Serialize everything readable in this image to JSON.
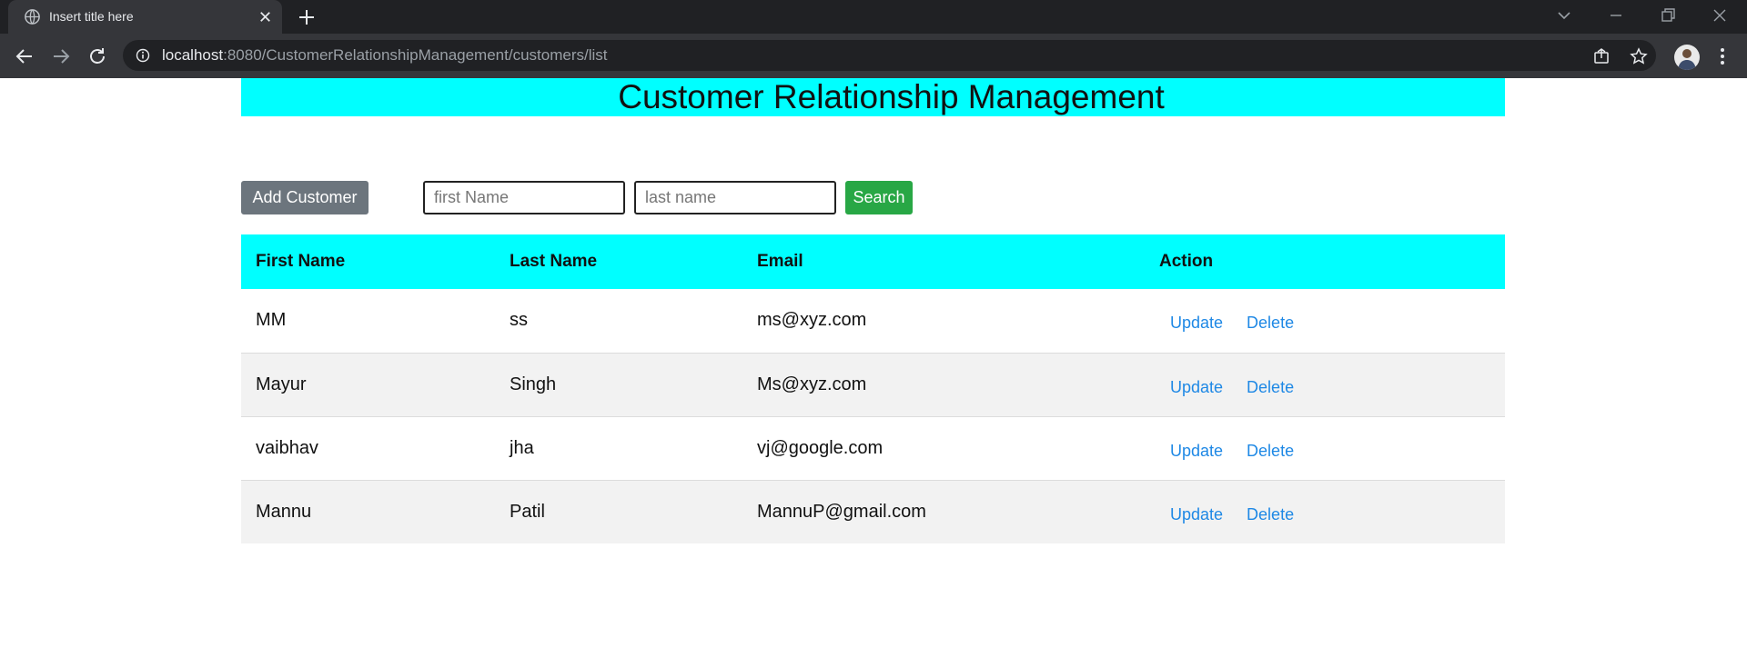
{
  "browser": {
    "tab_title": "Insert title here",
    "url_host": "localhost",
    "url_rest": ":8080/CustomerRelationshipManagement/customers/list"
  },
  "page": {
    "heading": "Customer Relationship Management",
    "add_button": "Add Customer",
    "first_name_placeholder": "first Name",
    "last_name_placeholder": "last name",
    "search_button": "Search"
  },
  "table": {
    "headers": [
      "First Name",
      "Last Name",
      "Email",
      "Action"
    ],
    "rows": [
      {
        "first": "MM",
        "last": "ss",
        "email": "ms@xyz.com",
        "update": "Update",
        "delete": "Delete"
      },
      {
        "first": "Mayur",
        "last": "Singh",
        "email": "Ms@xyz.com",
        "update": "Update",
        "delete": "Delete"
      },
      {
        "first": "vaibhav",
        "last": "jha",
        "email": "vj@google.com",
        "update": "Update",
        "delete": "Delete"
      },
      {
        "first": "Mannu",
        "last": "Patil",
        "email": "MannuP@gmail.com",
        "update": "Update",
        "delete": "Delete"
      }
    ]
  },
  "colors": {
    "header_accent": "#00ffff",
    "add_button": "#6c757d",
    "search_button": "#28a745",
    "link": "#1e88e5"
  },
  "icons": {
    "favicon": "globe-icon",
    "tab_close": "close-icon",
    "new_tab": "plus-icon",
    "back": "back-arrow-icon",
    "forward": "forward-arrow-icon",
    "reload": "reload-icon",
    "info": "info-icon",
    "share": "share-icon",
    "bookmark": "star-icon",
    "profile": "avatar",
    "menu": "kebab-menu-icon"
  }
}
